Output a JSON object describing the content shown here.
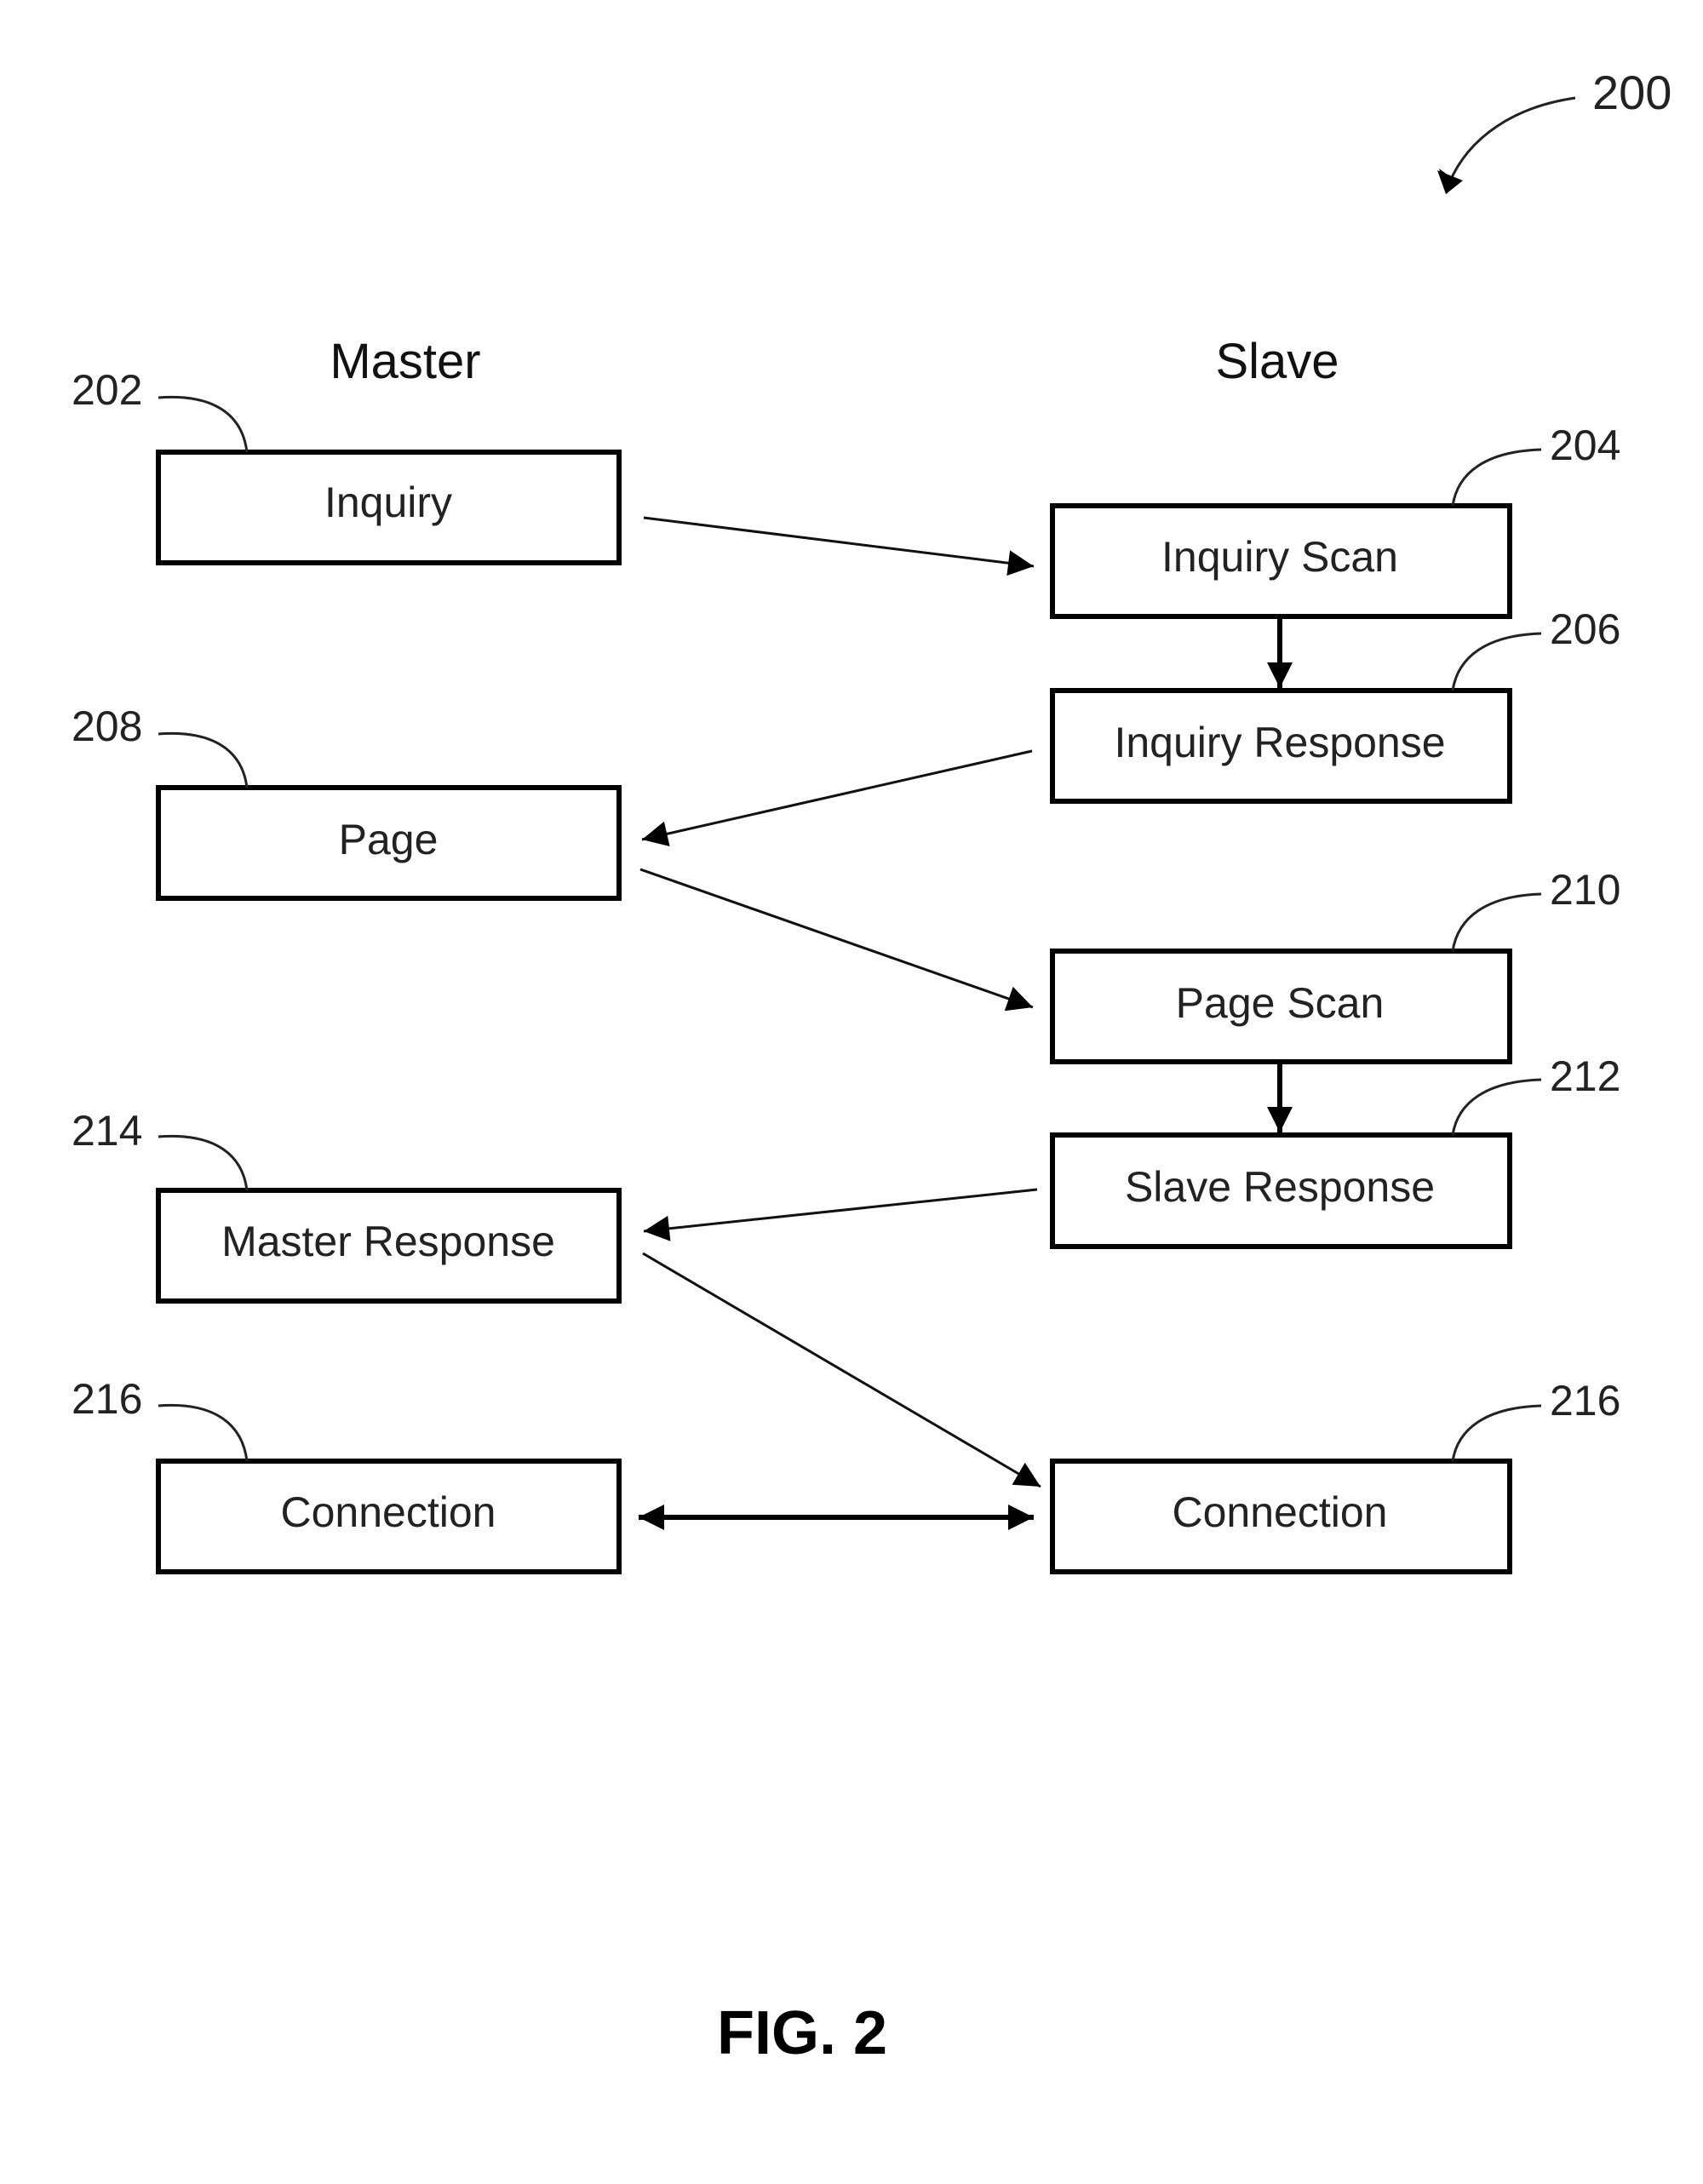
{
  "figure": {
    "label": "FIG. 2",
    "reference": "200"
  },
  "columns": {
    "master": "Master",
    "slave": "Slave"
  },
  "boxes": {
    "inquiry": {
      "label": "Inquiry",
      "ref": "202"
    },
    "inquiry_scan": {
      "label": "Inquiry Scan",
      "ref": "204"
    },
    "inquiry_response": {
      "label": "Inquiry Response",
      "ref": "206"
    },
    "page": {
      "label": "Page",
      "ref": "208"
    },
    "page_scan": {
      "label": "Page Scan",
      "ref": "210"
    },
    "slave_response": {
      "label": "Slave Response",
      "ref": "212"
    },
    "master_response": {
      "label": "Master Response",
      "ref": "214"
    },
    "master_connection": {
      "label": "Connection",
      "ref": "216"
    },
    "slave_connection": {
      "label": "Connection",
      "ref": "216"
    }
  },
  "flows": [
    {
      "from": "Inquiry",
      "to": "Inquiry Scan"
    },
    {
      "from": "Inquiry Scan",
      "to": "Inquiry Response"
    },
    {
      "from": "Inquiry Response",
      "to": "Page"
    },
    {
      "from": "Page",
      "to": "Page Scan"
    },
    {
      "from": "Page Scan",
      "to": "Slave Response"
    },
    {
      "from": "Slave Response",
      "to": "Master Response"
    },
    {
      "from": "Master Response",
      "to": "Connection (Slave)"
    },
    {
      "from": "Connection (Master)",
      "to": "Connection (Slave)",
      "bidirectional": true
    }
  ]
}
